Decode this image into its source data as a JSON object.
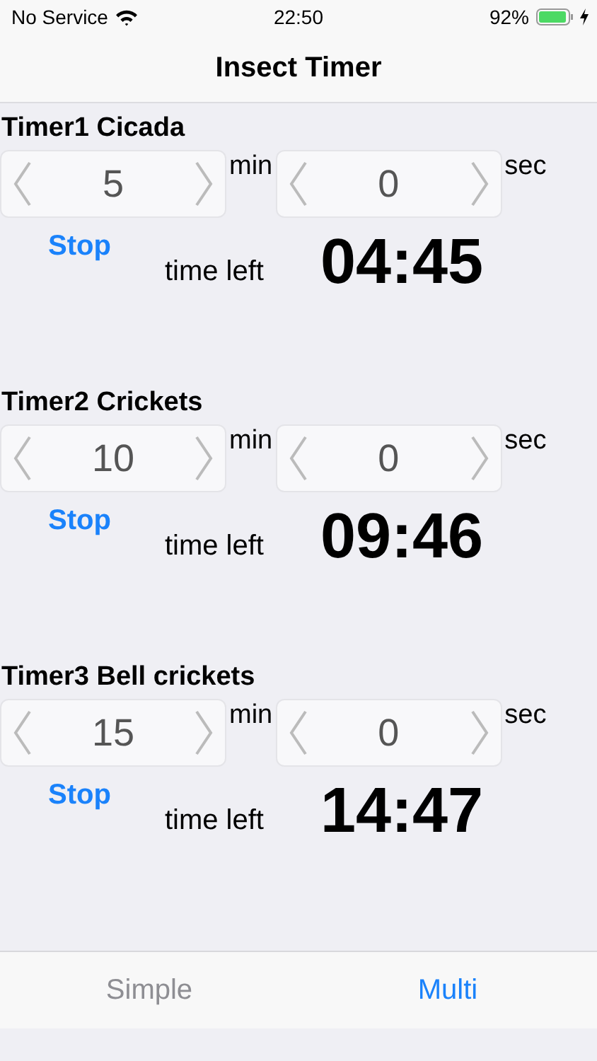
{
  "status_bar": {
    "carrier": "No Service",
    "time": "22:50",
    "battery": "92%"
  },
  "nav_bar": {
    "title": "Insect Timer"
  },
  "timers": [
    {
      "title": "Timer1 Cicada",
      "minutes": "5",
      "min_label": "min",
      "seconds": "0",
      "sec_label": "sec",
      "button": "Stop",
      "time_left_label": "time left",
      "remaining": "04:45"
    },
    {
      "title": "Timer2 Crickets",
      "minutes": "10",
      "min_label": "min",
      "seconds": "0",
      "sec_label": "sec",
      "button": "Stop",
      "time_left_label": "time left",
      "remaining": "09:46"
    },
    {
      "title": "Timer3 Bell crickets",
      "minutes": "15",
      "min_label": "min",
      "seconds": "0",
      "sec_label": "sec",
      "button": "Stop",
      "time_left_label": "time left",
      "remaining": "14:47"
    }
  ],
  "tabs": [
    {
      "label": "Simple",
      "selected": false
    },
    {
      "label": "Multi",
      "selected": true
    }
  ]
}
